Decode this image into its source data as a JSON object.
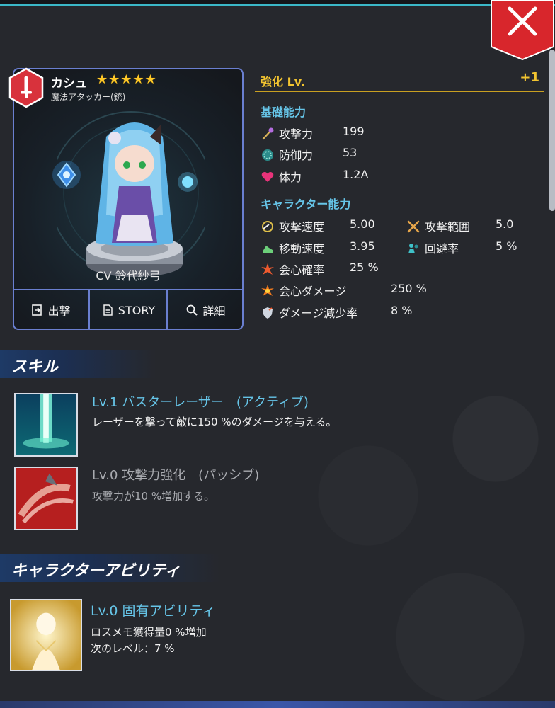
{
  "close": {
    "icon": "close-icon"
  },
  "character": {
    "name": "カシュ",
    "stars": "★★★★★",
    "role": "魔法アタッカー(銃)",
    "cv": "CV 鈴代紗弓",
    "element_icon": "sword-icon",
    "element_color": "#d8323c"
  },
  "card_buttons": {
    "sortie": "出撃",
    "story": "STORY",
    "detail": "詳細"
  },
  "upgrade": {
    "label": "強化 Lv.",
    "value": "+1"
  },
  "basic": {
    "title": "基礎能力",
    "attack_label": "攻撃力",
    "attack_value": "199",
    "defense_label": "防御力",
    "defense_value": "53",
    "hp_label": "体力",
    "hp_value": "1.2A"
  },
  "ability": {
    "title": "キャラクター能力",
    "atk_speed_label": "攻撃速度",
    "atk_speed_value": "5.00",
    "atk_range_label": "攻撃範囲",
    "atk_range_value": "5.0",
    "move_speed_label": "移動速度",
    "move_speed_value": "3.95",
    "evasion_label": "回避率",
    "evasion_value": "5 %",
    "crit_rate_label": "会心確率",
    "crit_rate_value": "25 %",
    "crit_dmg_label": "会心ダメージ",
    "crit_dmg_value": "250 %",
    "dmg_reduce_label": "ダメージ減少率",
    "dmg_reduce_value": "8 %"
  },
  "skills": {
    "header": "スキル",
    "items": [
      {
        "title": "Lv.1 バスターレーザー　(アクティブ)",
        "desc": "レーザーを撃って敵に150 %のダメージを与える。"
      },
      {
        "title": "Lv.0 攻撃力強化　(パッシブ)",
        "desc": "攻撃力が10 %増加する。"
      }
    ]
  },
  "abilities": {
    "header": "キャラクターアビリティ",
    "title": "Lv.0 固有アビリティ",
    "desc1": "ロスメモ獲得量0 %増加",
    "desc2": "次のレベル：7 %"
  },
  "colors": {
    "accent_blue": "#66c5e8",
    "gold": "#f2c430",
    "card_border": "#6a7fd0",
    "close_red": "#d8262c"
  }
}
